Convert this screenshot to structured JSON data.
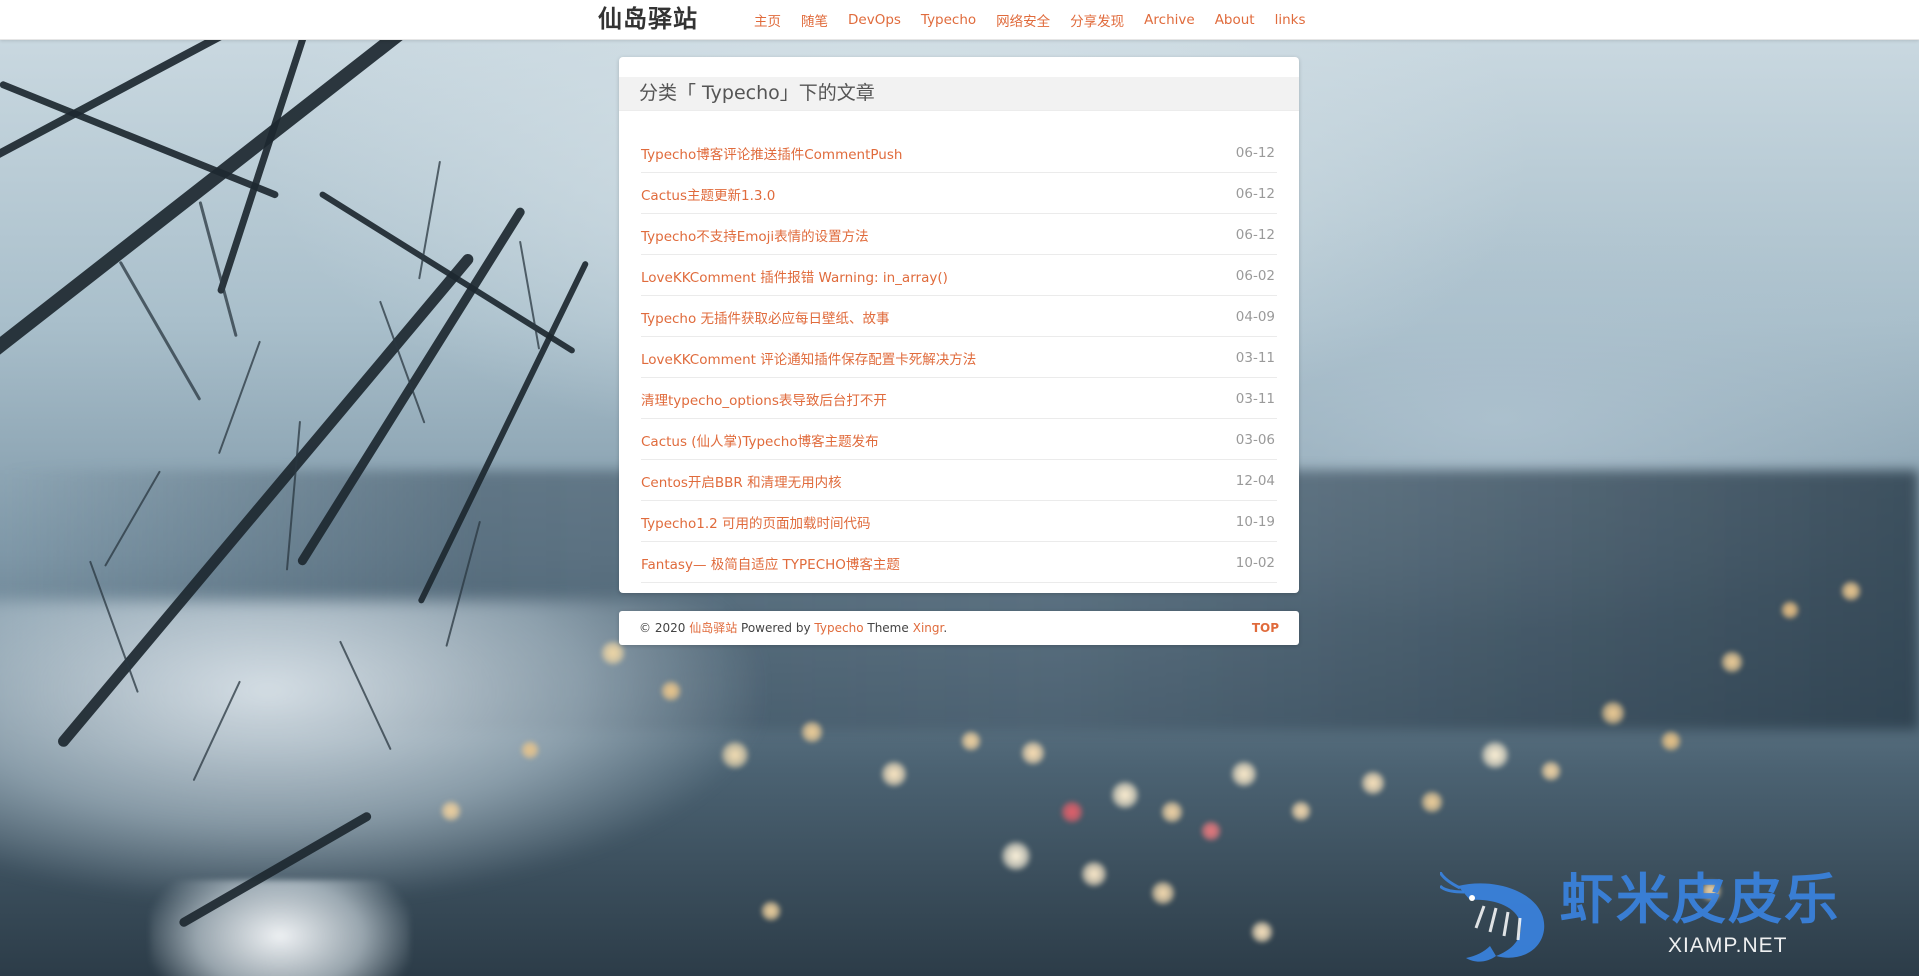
{
  "header": {
    "brand": "仙岛驿站",
    "nav": [
      "主页",
      "随笔",
      "DevOps",
      "Typecho",
      "网络安全",
      "分享发现",
      "Archive",
      "About",
      "links"
    ]
  },
  "main": {
    "title": "分类「 Typecho」下的文章",
    "posts": [
      {
        "title": "Typecho博客评论推送插件CommentPush",
        "date": "06-12"
      },
      {
        "title": "Cactus主题更新1.3.0",
        "date": "06-12"
      },
      {
        "title": "Typecho不支持Emoji表情的设置方法",
        "date": "06-12"
      },
      {
        "title": "LoveKKComment 插件报错 Warning: in_array()",
        "date": "06-02"
      },
      {
        "title": "Typecho 无插件获取必应每日壁纸、故事",
        "date": "04-09"
      },
      {
        "title": "LoveKKComment 评论通知插件保存配置卡死解决方法",
        "date": "03-11"
      },
      {
        "title": "清理typecho_options表导致后台打不开",
        "date": "03-11"
      },
      {
        "title": "Cactus (仙人掌)Typecho博客主题发布",
        "date": "03-06"
      },
      {
        "title": "Centos开启BBR 和清理无用内核",
        "date": "12-04"
      },
      {
        "title": "Typecho1.2 可用的页面加载时间代码",
        "date": "10-19"
      },
      {
        "title": "Fantasy— 极简自适应 TYPECHO博客主题",
        "date": "10-02"
      }
    ]
  },
  "footer": {
    "copyright": "© 2020",
    "site": "仙岛驿站",
    "powered_by": "Powered by",
    "typecho": "Typecho",
    "theme": "Theme",
    "theme_name": "Xingr",
    "period": ".",
    "top": "TOP"
  },
  "watermark": {
    "title": "虾米皮皮乐",
    "subtitle": "XIAMP.NET",
    "icon": "shrimp-logo-icon"
  },
  "colors": {
    "accent": "#e06b3c",
    "date": "#9a9a9a",
    "watermark": "#3a82de"
  }
}
